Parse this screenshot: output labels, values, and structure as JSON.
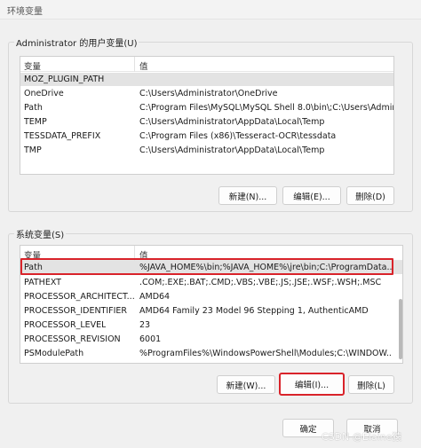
{
  "window": {
    "title": "环境变量"
  },
  "user_vars": {
    "group_label": "Administrator 的用户变量(U)",
    "columns": [
      "变量",
      "值"
    ],
    "rows": [
      {
        "name": "MOZ_PLUGIN_PATH",
        "value": ""
      },
      {
        "name": "OneDrive",
        "value": "C:\\Users\\Administrator\\OneDrive"
      },
      {
        "name": "Path",
        "value": "C:\\Program Files\\MySQL\\MySQL Shell 8.0\\bin\\;C:\\Users\\Admini"
      },
      {
        "name": "TEMP",
        "value": "C:\\Users\\Administrator\\AppData\\Local\\Temp"
      },
      {
        "name": "TESSDATA_PREFIX",
        "value": "C:\\Program Files (x86)\\Tesseract-OCR\\tessdata"
      },
      {
        "name": "TMP",
        "value": "C:\\Users\\Administrator\\AppData\\Local\\Temp"
      }
    ],
    "buttons": {
      "new": "新建(N)...",
      "edit": "编辑(E)...",
      "delete": "删除(D)"
    }
  },
  "system_vars": {
    "group_label": "系统变量(S)",
    "columns": [
      "变量",
      "值"
    ],
    "rows": [
      {
        "name": "Path",
        "value": "%JAVA_HOME%\\bin;%JAVA_HOME%\\jre\\bin;C:\\ProgramData..."
      },
      {
        "name": "PATHEXT",
        "value": ".COM;.EXE;.BAT;.CMD;.VBS;.VBE;.JS;.JSE;.WSF;.WSH;.MSC"
      },
      {
        "name": "PROCESSOR_ARCHITECT...",
        "value": "AMD64"
      },
      {
        "name": "PROCESSOR_IDENTIFIER",
        "value": "AMD64 Family 23 Model 96 Stepping 1, AuthenticAMD"
      },
      {
        "name": "PROCESSOR_LEVEL",
        "value": "23"
      },
      {
        "name": "PROCESSOR_REVISION",
        "value": "6001"
      },
      {
        "name": "PSModulePath",
        "value": "%ProgramFiles%\\WindowsPowerShell\\Modules;C:\\WINDOW..."
      }
    ],
    "buttons": {
      "new": "新建(W)...",
      "edit": "编辑(I)...",
      "delete": "删除(L)"
    }
  },
  "footer": {
    "ok": "确定",
    "cancel": "取消"
  },
  "watermark": "CSDN @Elaine猿",
  "colors": {
    "highlight": "#d9232a",
    "selected_row": "#e3e3e3"
  }
}
